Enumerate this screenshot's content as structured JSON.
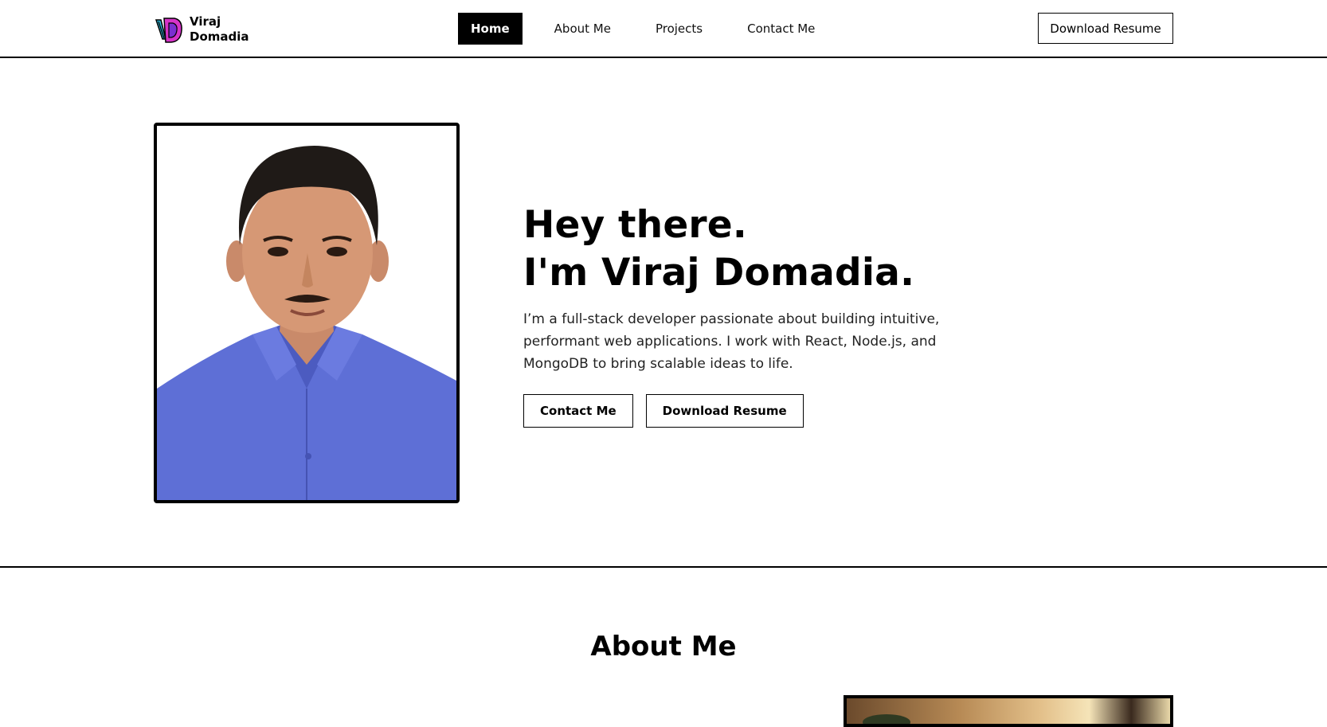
{
  "brand": {
    "name_line1": "Viraj",
    "name_line2": "Domadia",
    "logo_icon": "vd-monogram-icon",
    "colors": {
      "cyan": "#2bb5d6",
      "magenta": "#d633c8",
      "purple": "#7a2fd1"
    }
  },
  "nav": {
    "items": [
      {
        "label": "Home",
        "active": true
      },
      {
        "label": "About Me",
        "active": false
      },
      {
        "label": "Projects",
        "active": false
      },
      {
        "label": "Contact Me",
        "active": false
      }
    ],
    "resume_label": "Download Resume"
  },
  "hero": {
    "greeting": "Hey there.",
    "name_line": "I'm Viraj Domadia.",
    "description": "I’m a full-stack developer passionate about building intuitive, performant web applications. I work with React, Node.js, and MongoDB to bring scalable ideas to life.",
    "contact_label": "Contact Me",
    "resume_label": "Download Resume"
  },
  "about": {
    "title": "About Me"
  },
  "colors": {
    "text": "#000000",
    "background": "#ffffff",
    "active_nav_bg": "#000000",
    "shirt": "#5e6fd6"
  }
}
